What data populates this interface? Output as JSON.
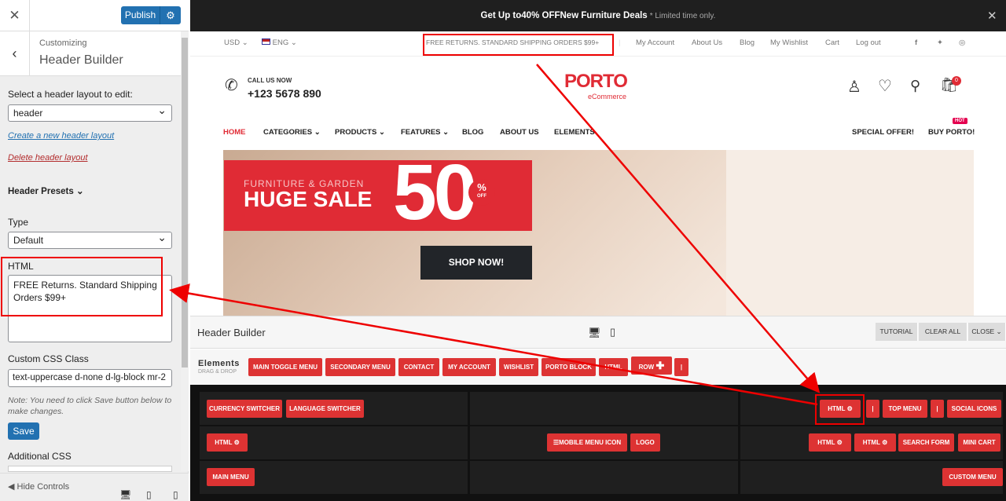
{
  "sidebar": {
    "publish_label": "Publish",
    "customizing": "Customizing",
    "title": "Header Builder",
    "layout_label": "Select a header layout to edit:",
    "layout_value": "header",
    "create_link": "Create a new header layout",
    "delete_link": "Delete header layout",
    "presets_label": "Header Presets",
    "type_label": "Type",
    "type_value": "Default",
    "html_label": "HTML",
    "html_value": "FREE Returns. Standard Shipping Orders $99+",
    "css_label": "Custom CSS Class",
    "css_value": "text-uppercase d-none d-lg-block mr-2",
    "note": "Note: You need to click Save button below to make changes.",
    "save_label": "Save",
    "additional_css": "Additional CSS",
    "hide_controls": "Hide Controls"
  },
  "banner": {
    "pre": "Get Up to ",
    "bold": "40% OFF",
    "post": " New Furniture Deals",
    "muted": "* Limited time only."
  },
  "topbar": {
    "currency": "USD",
    "language": "ENG",
    "promo": "FREE RETURNS. STANDARD SHIPPING ORDERS $99+",
    "links": [
      "My Account",
      "About Us",
      "Blog",
      "My Wishlist",
      "Cart",
      "Log out"
    ]
  },
  "header": {
    "call_us": "CALL US NOW",
    "phone": "+123 5678 890",
    "logo": "PORTO",
    "logo_sub": "eCommerce",
    "cart_count": "0"
  },
  "nav": {
    "items": [
      "HOME",
      "CATEGORIES",
      "PRODUCTS",
      "FEATURES",
      "BLOG",
      "ABOUT US",
      "ELEMENTS"
    ],
    "special": "SPECIAL OFFER!",
    "buy": "BUY PORTO!",
    "hot": "HOT"
  },
  "hero": {
    "line1": "FURNITURE & GARDEN",
    "line2": "HUGE SALE",
    "big": "50",
    "pct": "%",
    "off": "OFF",
    "cta": "SHOP NOW!"
  },
  "builder": {
    "title": "Header Builder",
    "tutorial": "TUTORIAL",
    "clear_all": "CLEAR ALL",
    "close": "CLOSE",
    "elements_title": "Elements",
    "elements_sub": "DRAG & DROP",
    "elements": [
      "MAIN TOGGLE MENU",
      "SECONDARY MENU",
      "CONTACT",
      "MY ACCOUNT",
      "WISHLIST",
      "PORTO BLOCK",
      "HTML",
      "ROW",
      "|"
    ],
    "row1_left": [
      "CURRENCY SWITCHER",
      "LANGUAGE SWITCHER"
    ],
    "row1_right": [
      "HTML",
      "|",
      "TOP MENU",
      "|",
      "SOCIAL ICONS"
    ],
    "row2_left": [
      "HTML"
    ],
    "row2_center": [
      "MOBILE MENU ICON",
      "LOGO"
    ],
    "row2_right": [
      "HTML",
      "HTML",
      "SEARCH FORM",
      "MINI CART"
    ],
    "row3_left": [
      "MAIN MENU"
    ],
    "row3_right": [
      "CUSTOM MENU"
    ]
  }
}
